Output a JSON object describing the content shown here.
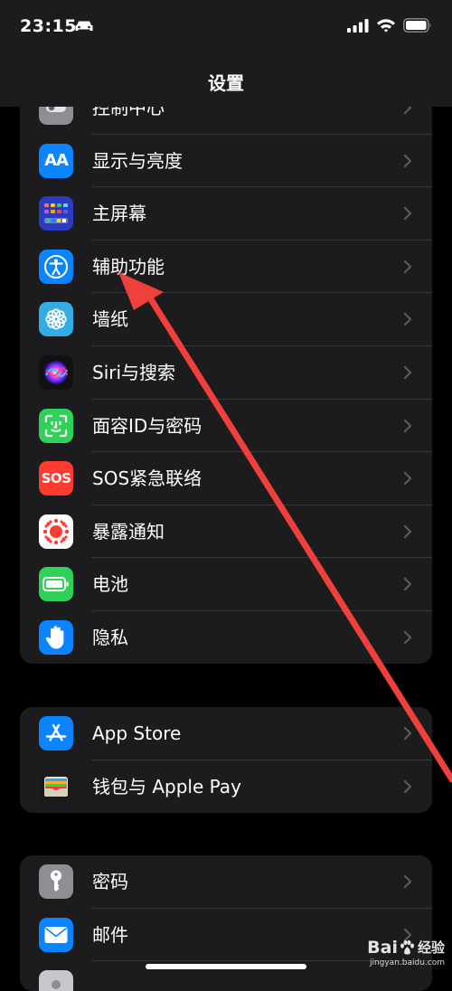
{
  "status": {
    "time": "23:15"
  },
  "nav": {
    "title": "设置"
  },
  "group1": [
    {
      "label": "控制中心"
    },
    {
      "label": "显示与亮度"
    },
    {
      "label": "主屏幕"
    },
    {
      "label": "辅助功能"
    },
    {
      "label": "墙纸"
    },
    {
      "label": "Siri与搜索"
    },
    {
      "label": "面容ID与密码"
    },
    {
      "label": "SOS紧急联络",
      "icon_text": "SOS"
    },
    {
      "label": "暴露通知"
    },
    {
      "label": "电池"
    },
    {
      "label": "隐私"
    }
  ],
  "group2": [
    {
      "label": "App Store"
    },
    {
      "label": "钱包与 Apple Pay"
    }
  ],
  "group3": [
    {
      "label": "密码"
    },
    {
      "label": "邮件"
    }
  ],
  "display_icon_text": "AA",
  "watermark": {
    "brand_left": "Bai",
    "brand_right": "经验",
    "url": "jingyan.baidu.com"
  },
  "colors": {
    "background": "#000000",
    "cell": "#1c1c1e",
    "separator": "#38383a",
    "chevron": "#5a5a5e",
    "annotation_arrow": "#f0403c"
  }
}
